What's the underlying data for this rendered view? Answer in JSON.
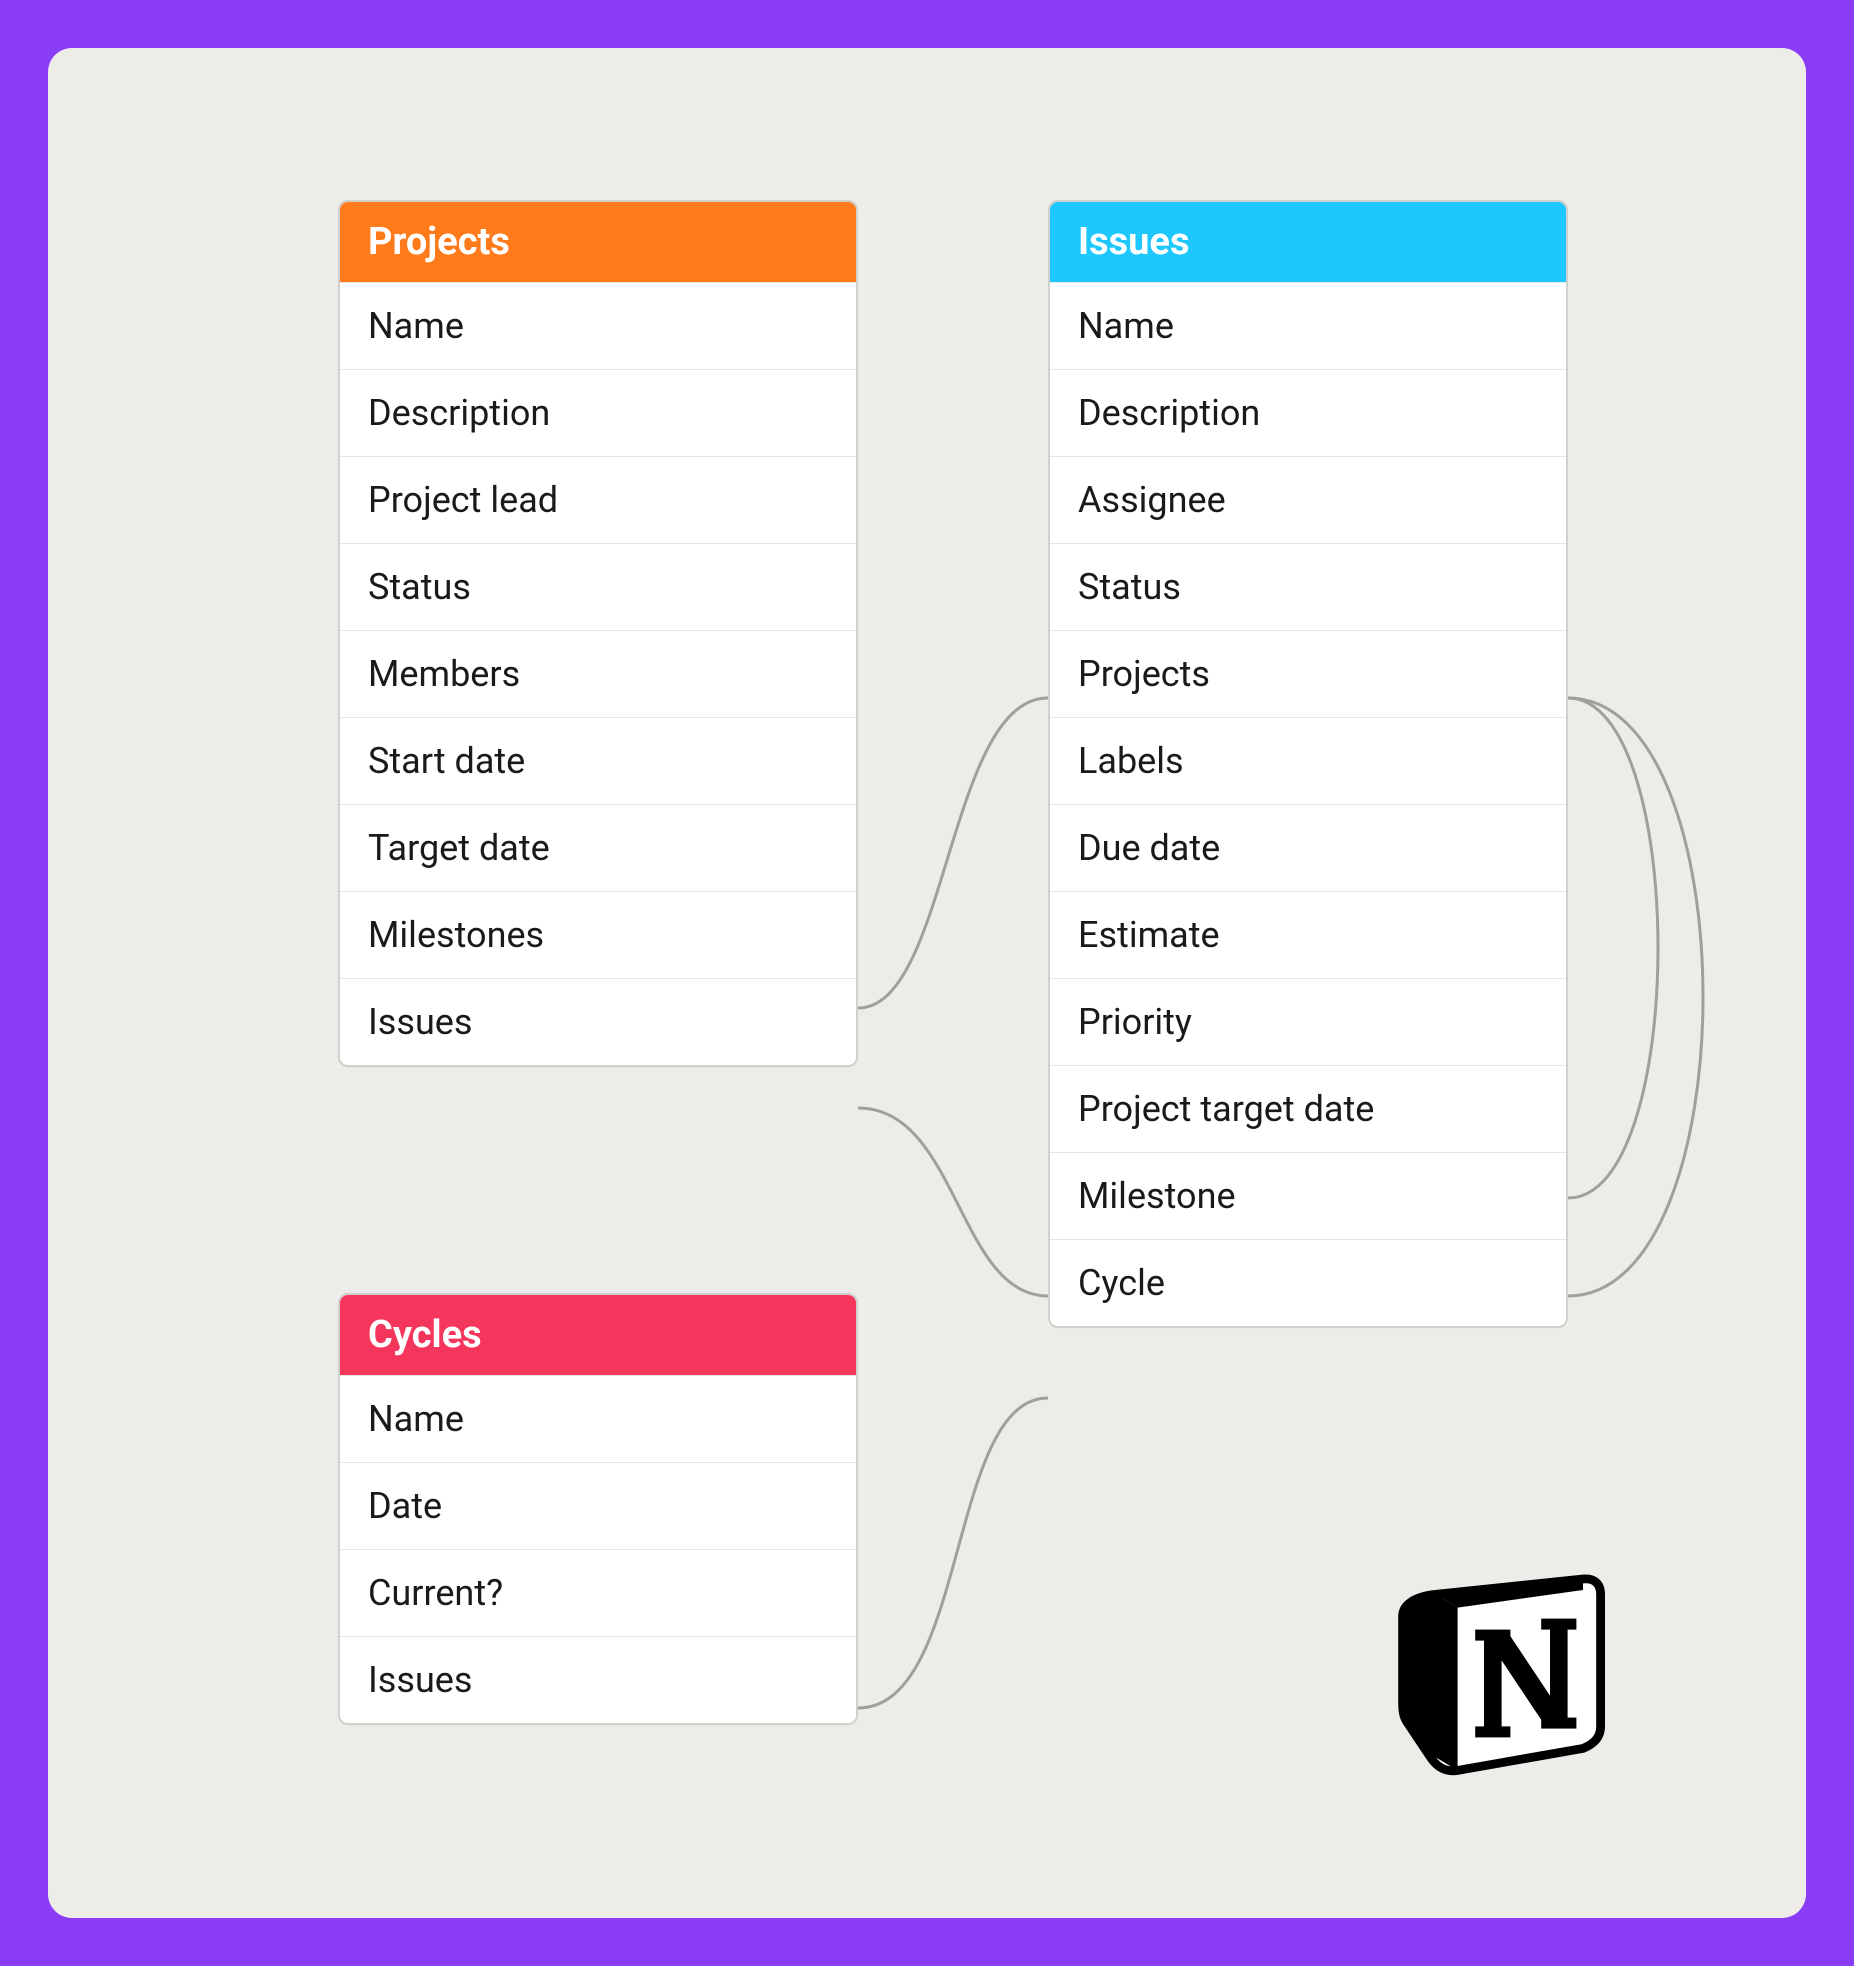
{
  "entities": {
    "projects": {
      "title": "Projects",
      "color": "#ff7a1a",
      "fields": [
        "Name",
        "Description",
        "Project lead",
        "Status",
        "Members",
        "Start date",
        "Target date",
        "Milestones",
        "Issues"
      ]
    },
    "issues": {
      "title": "Issues",
      "color": "#1ec8ff",
      "fields": [
        "Name",
        "Description",
        "Assignee",
        "Status",
        "Projects",
        "Labels",
        "Due date",
        "Estimate",
        "Priority",
        "Project target date",
        "Milestone",
        "Cycle"
      ]
    },
    "cycles": {
      "title": "Cycles",
      "color": "#f5365c",
      "fields": [
        "Name",
        "Date",
        "Current?",
        "Issues"
      ]
    }
  },
  "relationships": [
    {
      "from": "projects.Milestones",
      "to": "issues.Projects"
    },
    {
      "from": "projects.Issues",
      "to": "issues.Milestone"
    },
    {
      "from": "cycles.Issues",
      "to": "issues.Cycle"
    },
    {
      "from": "issues.Projects",
      "to": "issues.Project target date",
      "side": "right-loop"
    },
    {
      "from": "issues.Projects",
      "to": "issues.Milestone",
      "side": "right-loop"
    }
  ],
  "logo": "notion-like-logo"
}
